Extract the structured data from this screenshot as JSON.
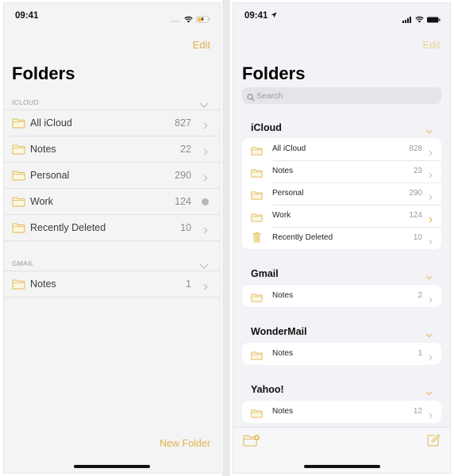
{
  "colors": {
    "accent": "#e0b24a",
    "accent_light": "#ecd294",
    "folder_stroke": "#e3c46e"
  },
  "left": {
    "status": {
      "time": "09:41",
      "icons": [
        "signal-dots-icon",
        "wifi-icon",
        "battery-charging-icon"
      ]
    },
    "edit_label": "Edit",
    "title": "Folders",
    "sections": [
      {
        "header": "ICLOUD",
        "rows": [
          {
            "name": "All iCloud",
            "count": "827",
            "accessory": "chevron"
          },
          {
            "name": "Notes",
            "count": "22",
            "accessory": "chevron"
          },
          {
            "name": "Personal",
            "count": "290",
            "accessory": "chevron"
          },
          {
            "name": "Work",
            "count": "124",
            "accessory": "info-dot"
          },
          {
            "name": "Recently Deleted",
            "count": "10",
            "accessory": "chevron"
          }
        ]
      },
      {
        "header": "GMAIL",
        "rows": [
          {
            "name": "Notes",
            "count": "1",
            "accessory": "chevron"
          }
        ]
      }
    ],
    "new_folder_label": "New Folder"
  },
  "right": {
    "status": {
      "time": "09:41",
      "icons": [
        "location-arrow-icon",
        "cellular-signal-icon",
        "wifi-icon",
        "battery-full-icon"
      ]
    },
    "edit_label": "Edit",
    "title": "Folders",
    "search": {
      "placeholder": "Search",
      "value": ""
    },
    "groups": [
      {
        "name": "iCloud",
        "rows": [
          {
            "name": "All iCloud",
            "count": "828",
            "icon": "folder"
          },
          {
            "name": "Notes",
            "count": "23",
            "icon": "folder"
          },
          {
            "name": "Personal",
            "count": "290",
            "icon": "folder"
          },
          {
            "name": "Work",
            "count": "124",
            "icon": "folder"
          },
          {
            "name": "Recently Deleted",
            "count": "10",
            "icon": "trash"
          }
        ]
      },
      {
        "name": "Gmail",
        "rows": [
          {
            "name": "Notes",
            "count": "2",
            "icon": "folder"
          }
        ]
      },
      {
        "name": "WonderMail",
        "rows": [
          {
            "name": "Notes",
            "count": "1",
            "icon": "folder"
          }
        ]
      },
      {
        "name": "Yahoo!",
        "rows": [
          {
            "name": "Notes",
            "count": "12",
            "icon": "folder"
          }
        ]
      }
    ],
    "toolbar": {
      "new_folder_icon": "folder-badge-plus-icon",
      "compose_icon": "compose-icon"
    }
  }
}
